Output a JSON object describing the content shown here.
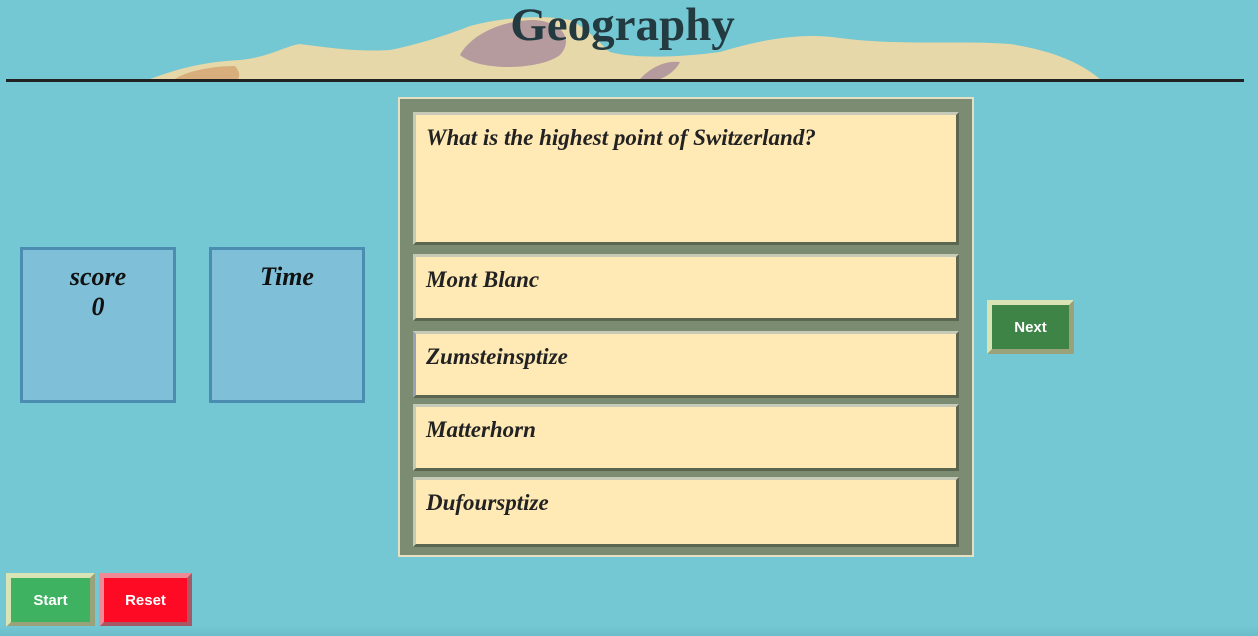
{
  "header": {
    "title": "Geography"
  },
  "score_box": {
    "label": "score",
    "value": "0"
  },
  "time_box": {
    "label": "Time",
    "value": ""
  },
  "quiz": {
    "question": "What is the highest point of Switzerland?",
    "options": [
      "Mont Blanc",
      "Zumsteinsptize",
      "Matterhorn",
      "Dufoursptize"
    ]
  },
  "buttons": {
    "next": "Next",
    "start": "Start",
    "reset": "Reset"
  },
  "colors": {
    "background": "#73c8d3",
    "card": "#ffe9b5",
    "panel": "#7c8c72",
    "next": "#3e8446",
    "start": "#3fb262",
    "reset": "#ff0a24"
  }
}
